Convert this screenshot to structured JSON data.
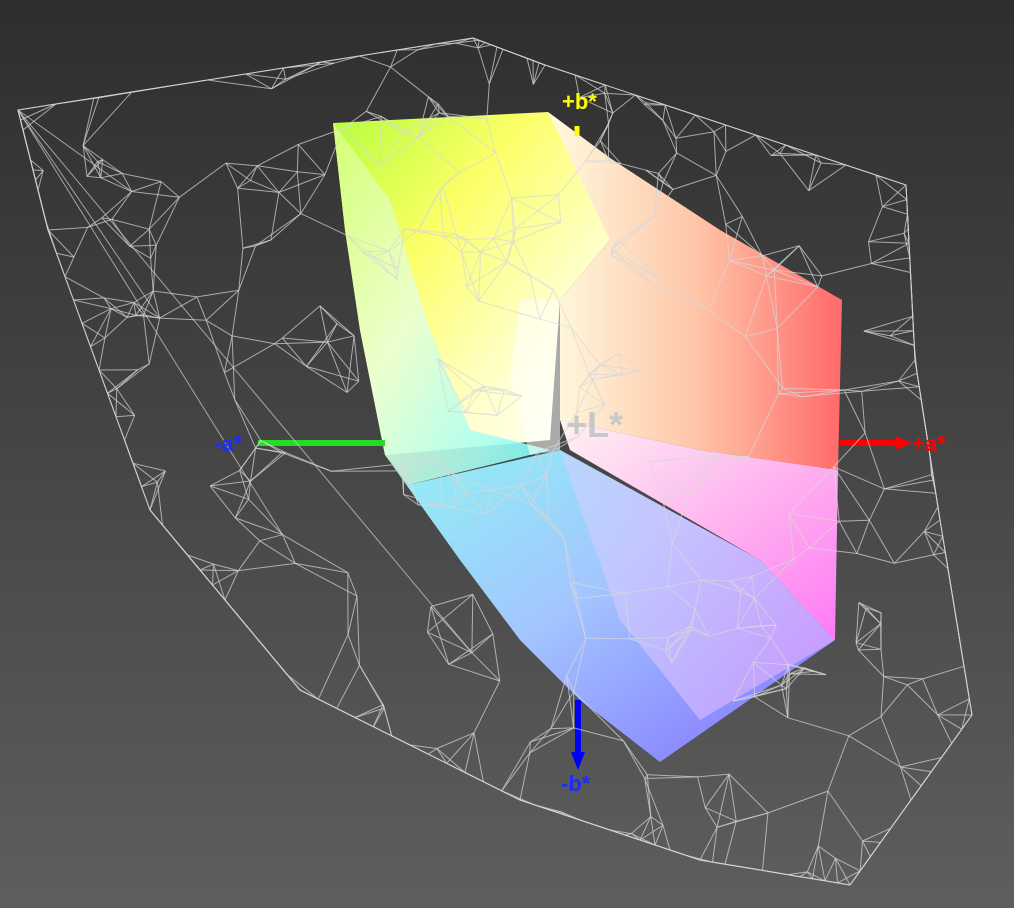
{
  "axes": {
    "plus_b": {
      "text": "+b*",
      "color": "#ffff00"
    },
    "minus_b": {
      "text": "-b*",
      "color": "#1a2cff"
    },
    "plus_a": {
      "text": "+a*",
      "color": "#ff0000"
    },
    "minus_a": {
      "text": "-a*",
      "color": "#1a2cff"
    },
    "plus_L": {
      "text": "+L*",
      "color": "#c8c8c8"
    }
  },
  "colors": {
    "wireframe": "#d8d8d8",
    "axis_green": "#22dd22",
    "axis_red": "#ff0000",
    "axis_blue": "#0000ff",
    "axis_yellow": "#ffff00"
  }
}
